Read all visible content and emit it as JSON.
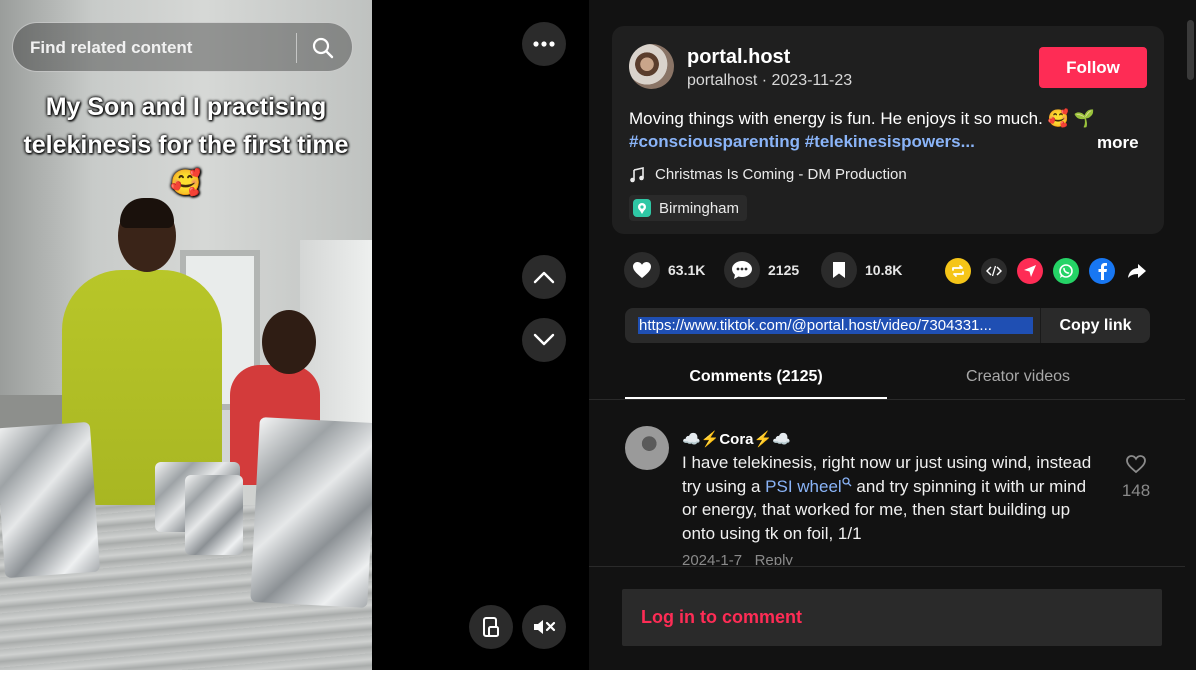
{
  "search": {
    "placeholder": "Find related content"
  },
  "video": {
    "caption": "My Son and I practising telekinesis for the first time🥰"
  },
  "author": {
    "display_name": "portal.host",
    "handle": "portalhost",
    "date": "2023-11-23",
    "follow_label": "Follow"
  },
  "description": {
    "text": "Moving things with energy is fun. He enjoys it so much. 🥰 🌱",
    "hashtags": "#consciousparenting #telekinesispowers...",
    "more_label": "more"
  },
  "music": {
    "title": "Christmas Is Coming - DM Production"
  },
  "location": {
    "name": "Birmingham"
  },
  "stats": {
    "likes": "63.1K",
    "comments": "2125",
    "saves": "10.8K"
  },
  "share_icons": [
    "repost-icon",
    "embed-icon",
    "send-icon",
    "whatsapp-icon",
    "facebook-icon",
    "share-arrow-icon"
  ],
  "link": {
    "url": "https://www.tiktok.com/@portal.host/video/7304331...",
    "copy_label": "Copy link"
  },
  "tabs": {
    "comments": "Comments (2125)",
    "creator": "Creator videos"
  },
  "comment": {
    "author": "☁️⚡Cora⚡☁️",
    "text_before": "I have telekinesis, right now ur just using wind, instead try using a ",
    "link_text": "PSI wheel",
    "text_after": " and try spinning it with ur mind or energy, that worked for me, then start building up onto using tk on foil, 1/1",
    "date": "2024-1-7",
    "reply_label": "Reply",
    "likes": "148"
  },
  "login": {
    "label": "Log in to comment"
  },
  "colors": {
    "accent": "#fe2c55",
    "link": "#8ab4f8",
    "panel_bg": "#121212",
    "card_bg": "#1f1f1f"
  }
}
